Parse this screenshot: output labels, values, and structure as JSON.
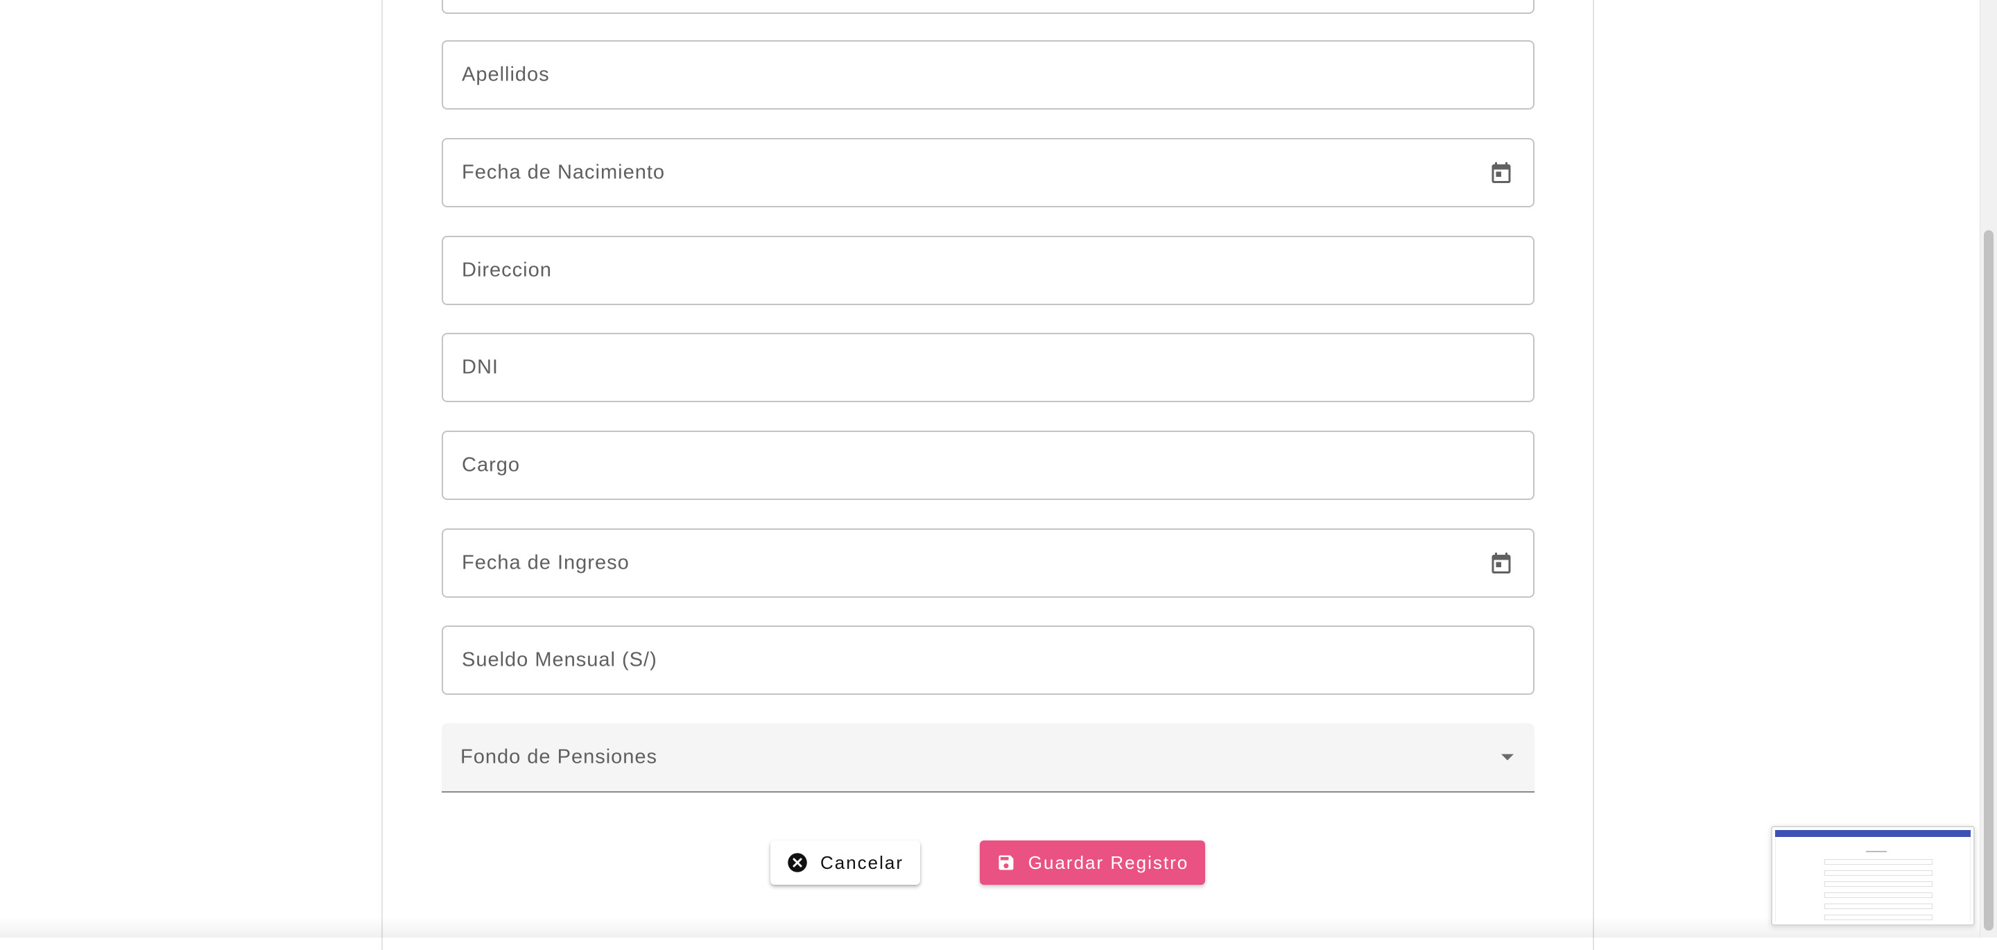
{
  "form": {
    "fields": [
      {
        "label": "Apellidos",
        "type": "text"
      },
      {
        "label": "Fecha de Nacimiento",
        "type": "date",
        "icon": "calendar-icon"
      },
      {
        "label": "Direccion",
        "type": "text"
      },
      {
        "label": "DNI",
        "type": "text"
      },
      {
        "label": "Cargo",
        "type": "text"
      },
      {
        "label": "Fecha de Ingreso",
        "type": "date",
        "icon": "calendar-icon"
      },
      {
        "label": "Sueldo Mensual (S/)",
        "type": "text"
      }
    ],
    "select": {
      "label": "Fondo de Pensiones",
      "icon": "dropdown-arrow-icon"
    }
  },
  "actions": {
    "cancel_label": "Cancelar",
    "cancel_icon": "cancel-circle-icon",
    "save_label": "Guardar Registro",
    "save_icon": "save-icon"
  },
  "colors": {
    "save_button": "#ea5283",
    "field_border": "#c4c4c4",
    "label_text": "#5f5f5f",
    "select_background": "#f5f5f5",
    "minimap_header": "#3f51b5"
  }
}
